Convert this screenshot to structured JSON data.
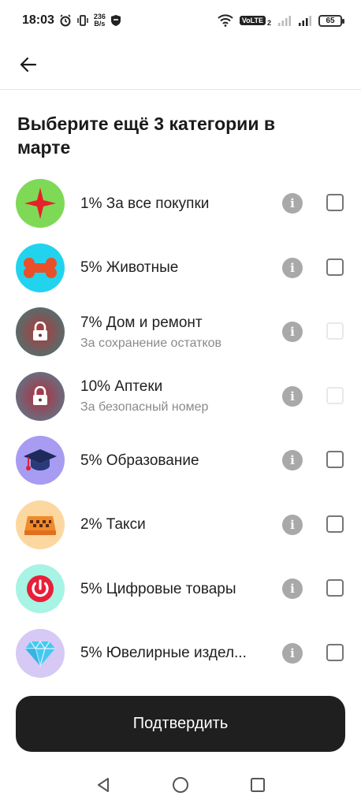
{
  "status_bar": {
    "time": "18:03",
    "speed_value": "236",
    "speed_unit": "B/s",
    "volte": "VoLTE",
    "sim_index": "2",
    "battery": "65"
  },
  "title": "Выберите ещё 3 категории в марте",
  "categories": [
    {
      "label": "1% За все покупки",
      "sub": "",
      "icon": "star-icon",
      "bg": "#7ed957",
      "disabled": false
    },
    {
      "label": "5% Животные",
      "sub": "",
      "icon": "bone-icon",
      "bg": "#22d3ee",
      "disabled": false
    },
    {
      "label": "7% Дом и ремонт",
      "sub": "За сохранение остатков",
      "icon": "lock-icon",
      "bg": "#4a6b6b",
      "disabled": true
    },
    {
      "label": "10% Аптеки",
      "sub": "За безопасный номер",
      "icon": "lock-icon",
      "bg": "#6b6b7d",
      "disabled": true
    },
    {
      "label": "5% Образование",
      "sub": "",
      "icon": "graduation-cap-icon",
      "bg": "#a79cf2",
      "disabled": false
    },
    {
      "label": "2% Такси",
      "sub": "",
      "icon": "taxi-icon",
      "bg": "#fcd8a0",
      "disabled": false
    },
    {
      "label": "5% Цифровые товары",
      "sub": "",
      "icon": "power-icon",
      "bg": "#a7f3e4",
      "disabled": false
    },
    {
      "label": "5% Ювелирные издел...",
      "sub": "",
      "icon": "diamond-icon",
      "bg": "#d6c9f5",
      "disabled": false
    }
  ],
  "info_glyph": "i",
  "confirm_label": "Подтвердить"
}
